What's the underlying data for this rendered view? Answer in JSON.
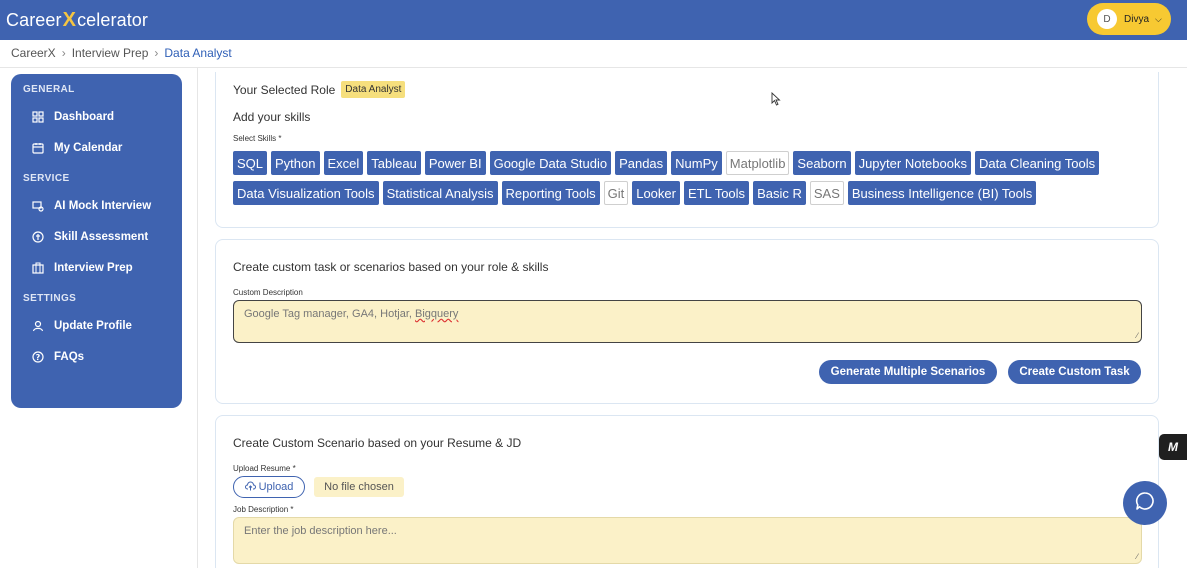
{
  "header": {
    "logo_pre": "Career",
    "logo_x": "X",
    "logo_post": "celerator",
    "user_initial": "D",
    "user_name": "Divya",
    "chevron": "⌄"
  },
  "breadcrumb": [
    "CareerX",
    "Interview Prep",
    "Data Analyst"
  ],
  "sidebar": {
    "sections": [
      {
        "title": "GENERAL",
        "items": [
          {
            "label": "Dashboard",
            "icon": "grid-icon"
          },
          {
            "label": "My Calendar",
            "icon": "calendar-icon"
          }
        ]
      },
      {
        "title": "SERVICE",
        "items": [
          {
            "label": "AI Mock Interview",
            "icon": "mock-interview-icon"
          },
          {
            "label": "Skill Assessment",
            "icon": "assessment-icon"
          },
          {
            "label": "Interview Prep",
            "icon": "briefcase-icon"
          }
        ]
      },
      {
        "title": "SETTINGS",
        "items": [
          {
            "label": "Update Profile",
            "icon": "user-icon"
          },
          {
            "label": "FAQs",
            "icon": "help-icon"
          }
        ]
      }
    ]
  },
  "role_card": {
    "selected_role_label": "Your Selected Role",
    "selected_role": "Data Analyst",
    "add_skills": "Add your skills",
    "select_skills_label": "Select Skills *",
    "skills": [
      {
        "name": "SQL",
        "selected": true
      },
      {
        "name": "Python",
        "selected": true
      },
      {
        "name": "Excel",
        "selected": true
      },
      {
        "name": "Tableau",
        "selected": true
      },
      {
        "name": "Power BI",
        "selected": true
      },
      {
        "name": "Google Data Studio",
        "selected": true
      },
      {
        "name": "Pandas",
        "selected": true
      },
      {
        "name": "NumPy",
        "selected": true
      },
      {
        "name": "Matplotlib",
        "selected": false
      },
      {
        "name": "Seaborn",
        "selected": true
      },
      {
        "name": "Jupyter Notebooks",
        "selected": true
      },
      {
        "name": "Data Cleaning Tools",
        "selected": true
      },
      {
        "name": "Data Visualization Tools",
        "selected": true
      },
      {
        "name": "Statistical Analysis",
        "selected": true
      },
      {
        "name": "Reporting Tools",
        "selected": true
      },
      {
        "name": "Git",
        "selected": false
      },
      {
        "name": "Looker",
        "selected": true
      },
      {
        "name": "ETL Tools",
        "selected": true
      },
      {
        "name": "Basic R",
        "selected": true
      },
      {
        "name": "SAS",
        "selected": false
      },
      {
        "name": "Business Intelligence (BI) Tools",
        "selected": true
      }
    ]
  },
  "custom_task_card": {
    "title": "Create custom task or scenarios based on your role & skills",
    "desc_label": "Custom Description",
    "desc_value_plain": "Google Tag manager, GA4, Hotjar, ",
    "desc_value_misspelled": "Bigquery",
    "generate_button": "Generate Multiple Scenarios",
    "create_button": "Create Custom Task"
  },
  "resume_card": {
    "title": "Create Custom Scenario based on your Resume & JD",
    "upload_label": "Upload Resume *",
    "upload_button": "Upload",
    "no_file": "No file chosen",
    "jd_label": "Job Description *",
    "jd_placeholder": "Enter the job description here..."
  },
  "floating": {
    "side_tab": "M",
    "colors": {
      "primary": "#3f63b0",
      "accent": "#f7c932",
      "field": "#fbf1c8"
    }
  }
}
